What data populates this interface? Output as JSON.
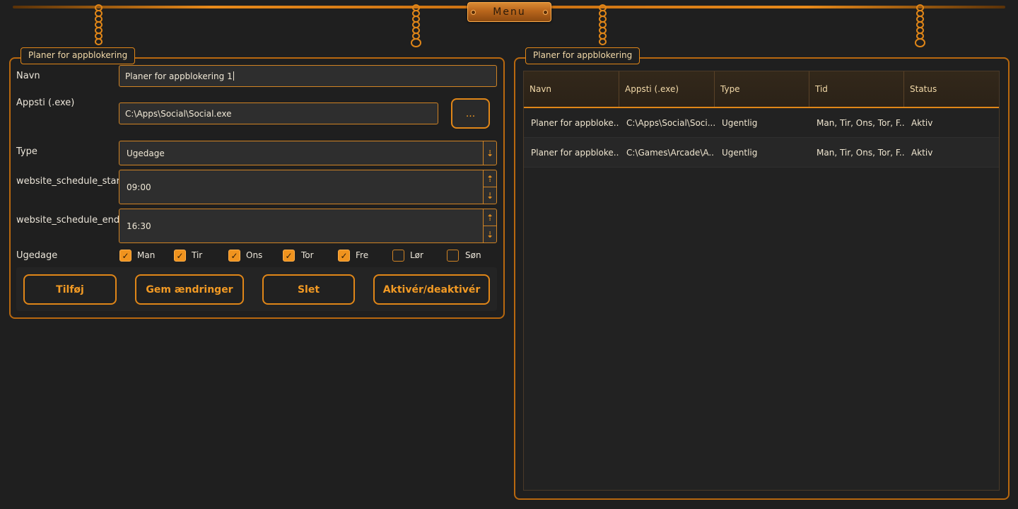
{
  "menu": {
    "label": "Menu"
  },
  "left_panel": {
    "title": "Planer for appblokering",
    "name_label": "Navn",
    "name_value": "Planer for appblokering 1",
    "path_label": "Appsti (.exe)",
    "path_value": "C:\\Apps\\Social\\Social.exe",
    "browse_label": "...",
    "type_label": "Type",
    "type_value": "Ugedage",
    "start_label": "website_schedule_start",
    "start_value": "09:00",
    "end_label": "website_schedule_end",
    "end_value": "16:30",
    "weekdays_label": "Ugedage",
    "days": [
      {
        "label": "Man",
        "checked": true
      },
      {
        "label": "Tir",
        "checked": true
      },
      {
        "label": "Ons",
        "checked": true
      },
      {
        "label": "Tor",
        "checked": true
      },
      {
        "label": "Fre",
        "checked": true
      },
      {
        "label": "Lør",
        "checked": false
      },
      {
        "label": "Søn",
        "checked": false
      }
    ],
    "buttons": {
      "add": "Tilføj",
      "save": "Gem ændringer",
      "delete": "Slet",
      "toggle": "Aktivér/deaktivér"
    }
  },
  "right_panel": {
    "title": "Planer for appblokering",
    "columns": [
      "Navn",
      "Appsti (.exe)",
      "Type",
      "Tid",
      "Status"
    ],
    "rows": [
      [
        "Planer for appbloke...",
        "C:\\Apps\\Social\\Soci...",
        "Ugentlig",
        "Man, Tir, Ons, Tor, F...",
        "Aktiv"
      ],
      [
        "Planer for appbloke...",
        "C:\\Games\\Arcade\\A...",
        "Ugentlig",
        "Man, Tir, Ons, Tor, F...",
        "Aktiv"
      ]
    ]
  },
  "icons": {
    "dropdown": "arrow-down-icon",
    "spin_up": "arrow-up-icon",
    "spin_down": "arrow-down-icon",
    "check": "checkmark-icon"
  },
  "colors": {
    "accent": "#e08618",
    "background": "#1f1f1f"
  }
}
